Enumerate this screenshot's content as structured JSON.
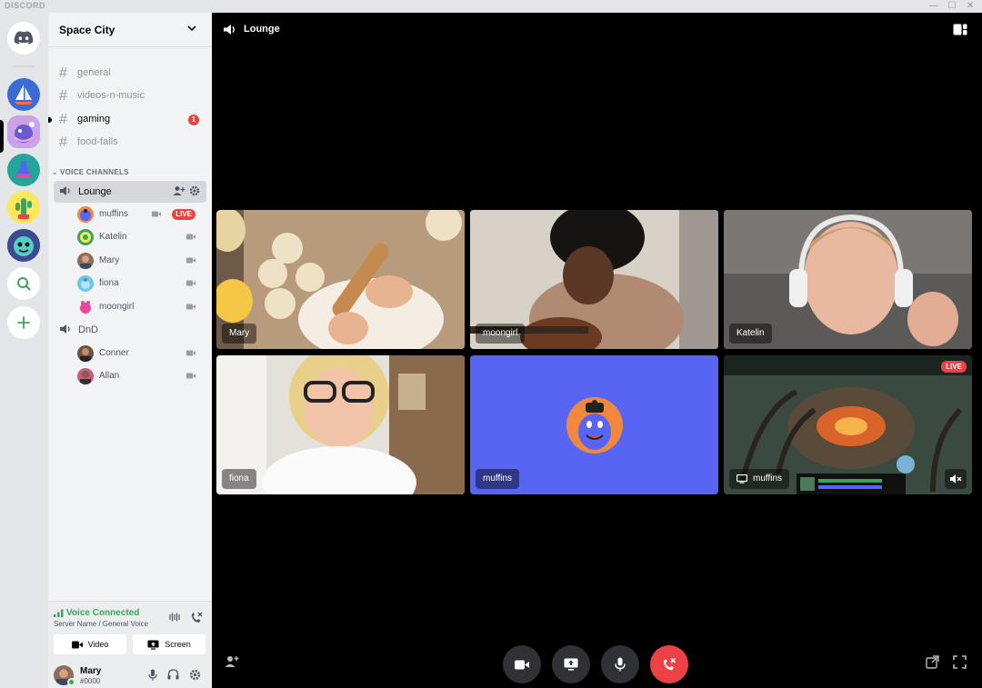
{
  "titlebar": {
    "brand": "DISCORD",
    "minimize": "—",
    "maximize": "☐",
    "close": "✕"
  },
  "server": {
    "name": "Space City"
  },
  "text_channels": [
    {
      "name": "general",
      "unread": false
    },
    {
      "name": "videos-n-music",
      "unread": false
    },
    {
      "name": "gaming",
      "unread": true,
      "mentions": "1"
    },
    {
      "name": "food-fails",
      "unread": false
    }
  ],
  "voice_category": "VOICE CHANNELS",
  "voice_channels": [
    {
      "name": "Lounge",
      "active": true,
      "members": [
        {
          "name": "muffins",
          "live": "LIVE"
        },
        {
          "name": "Katelin"
        },
        {
          "name": "Mary"
        },
        {
          "name": "fiona"
        },
        {
          "name": "moongirl"
        }
      ]
    },
    {
      "name": "DnD",
      "active": false,
      "members": [
        {
          "name": "Conner"
        },
        {
          "name": "Allan"
        }
      ]
    }
  ],
  "voice_connected": {
    "status": "Voice Connected",
    "location": "Server Name / General Voice",
    "video_label": "Video",
    "screen_label": "Screen"
  },
  "user": {
    "name": "Mary",
    "tag": "#0000"
  },
  "call": {
    "title": "Lounge",
    "tiles": [
      {
        "name": "Mary"
      },
      {
        "name": "moongirl"
      },
      {
        "name": "Katelin"
      },
      {
        "name": "fiona"
      },
      {
        "name": "muffins"
      },
      {
        "name": "muffins",
        "live": "LIVE"
      }
    ]
  },
  "colors": {
    "blurple": "#5865f2",
    "green": "#3ba55d",
    "red": "#ed4245",
    "sidebar": "#f2f3f5",
    "rail": "#e3e5e8"
  }
}
